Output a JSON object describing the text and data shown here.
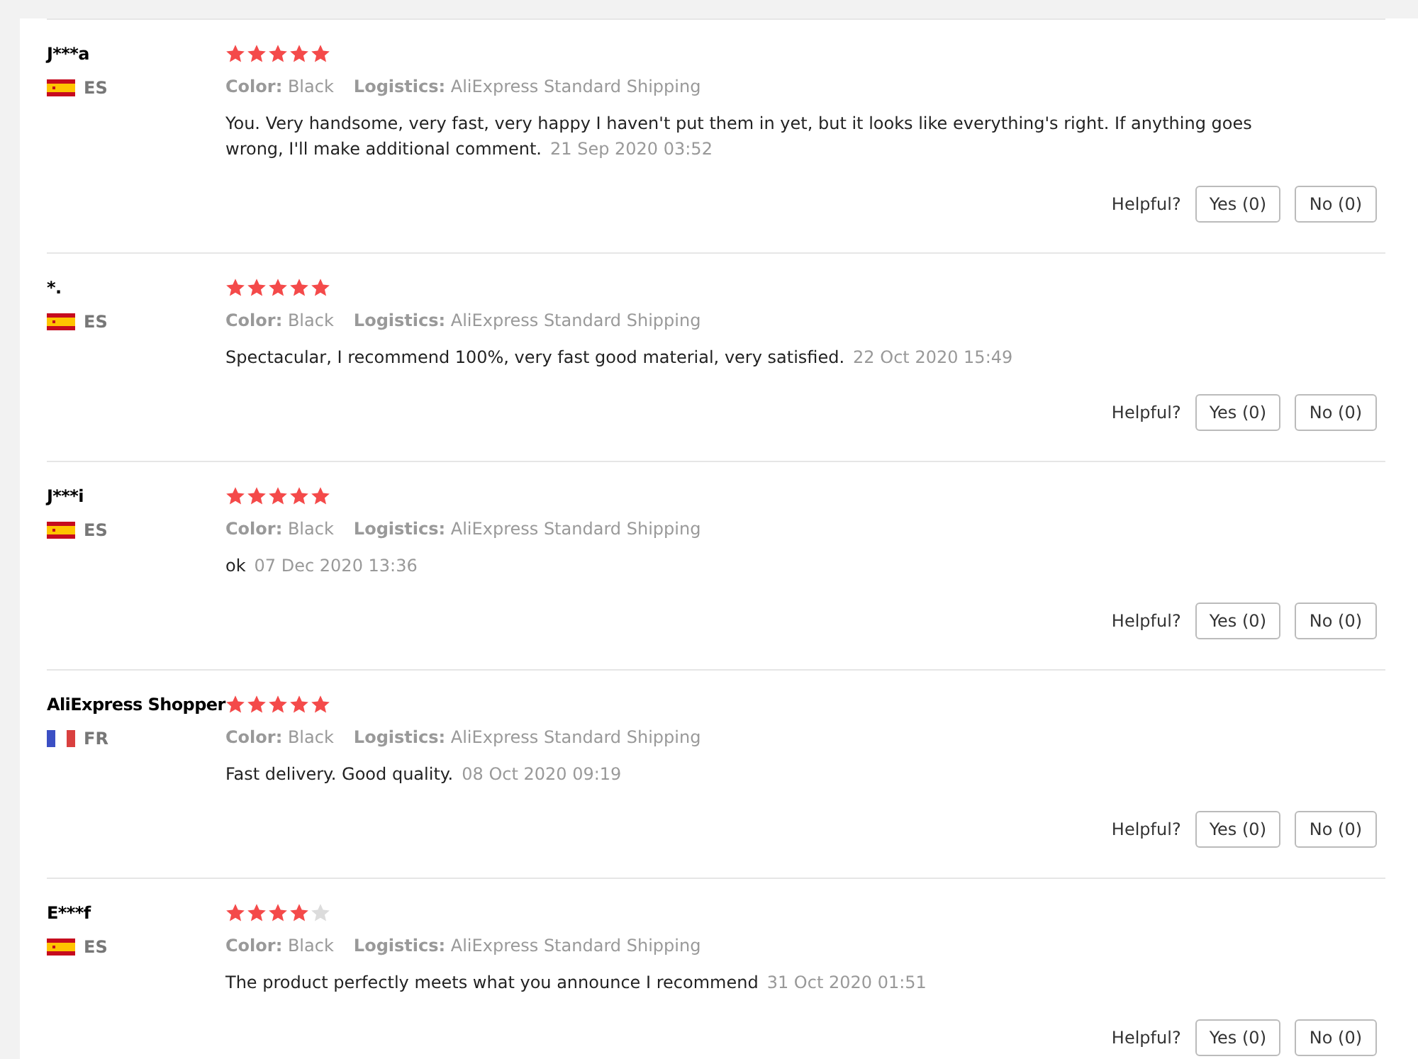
{
  "reviews": [
    {
      "name": "J***a",
      "kind": "spain",
      "country": "ES",
      "stars": 5,
      "color_label": "Color:",
      "color_value": "Black",
      "logistics_label": "Logistics:",
      "logistics_value": "AliExpress Standard Shipping",
      "text": "You. Very handsome, very fast, very happy I haven't put them in yet, but it looks like everything's right. If anything goes wrong, I'll make additional comment.",
      "date": "21 Sep 2020 03:52",
      "helpful_label": "Helpful?",
      "yes": "Yes (0)",
      "no": "No (0)"
    },
    {
      "name": "*.",
      "kind": "spain",
      "country": "ES",
      "stars": 5,
      "color_label": "Color:",
      "color_value": "Black",
      "logistics_label": "Logistics:",
      "logistics_value": "AliExpress Standard Shipping",
      "text": "Spectacular, I recommend 100%, very fast good material, very satisfied.",
      "date": "22 Oct 2020 15:49",
      "helpful_label": "Helpful?",
      "yes": "Yes (0)",
      "no": "No (0)"
    },
    {
      "name": "J***i",
      "kind": "spain",
      "country": "ES",
      "stars": 5,
      "color_label": "Color:",
      "color_value": "Black",
      "logistics_label": "Logistics:",
      "logistics_value": "AliExpress Standard Shipping",
      "text": "ok",
      "date": "07 Dec 2020 13:36",
      "helpful_label": "Helpful?",
      "yes": "Yes (0)",
      "no": "No (0)"
    },
    {
      "name": "AliExpress Shopper",
      "kind": "france",
      "country": "FR",
      "stars": 5,
      "color_label": "Color:",
      "color_value": "Black",
      "logistics_label": "Logistics:",
      "logistics_value": "AliExpress Standard Shipping",
      "text": "Fast delivery. Good quality.",
      "date": "08 Oct 2020 09:19",
      "helpful_label": "Helpful?",
      "yes": "Yes (0)",
      "no": "No (0)"
    },
    {
      "name": "E***f",
      "kind": "spain",
      "country": "ES",
      "stars": 4,
      "color_label": "Color:",
      "color_value": "Black",
      "logistics_label": "Logistics:",
      "logistics_value": "AliExpress Standard Shipping",
      "text": "The product perfectly meets what you announce I recommend",
      "date": "31 Oct 2020 01:51",
      "helpful_label": "Helpful?",
      "yes": "Yes (0)",
      "no": "No (0)"
    }
  ]
}
